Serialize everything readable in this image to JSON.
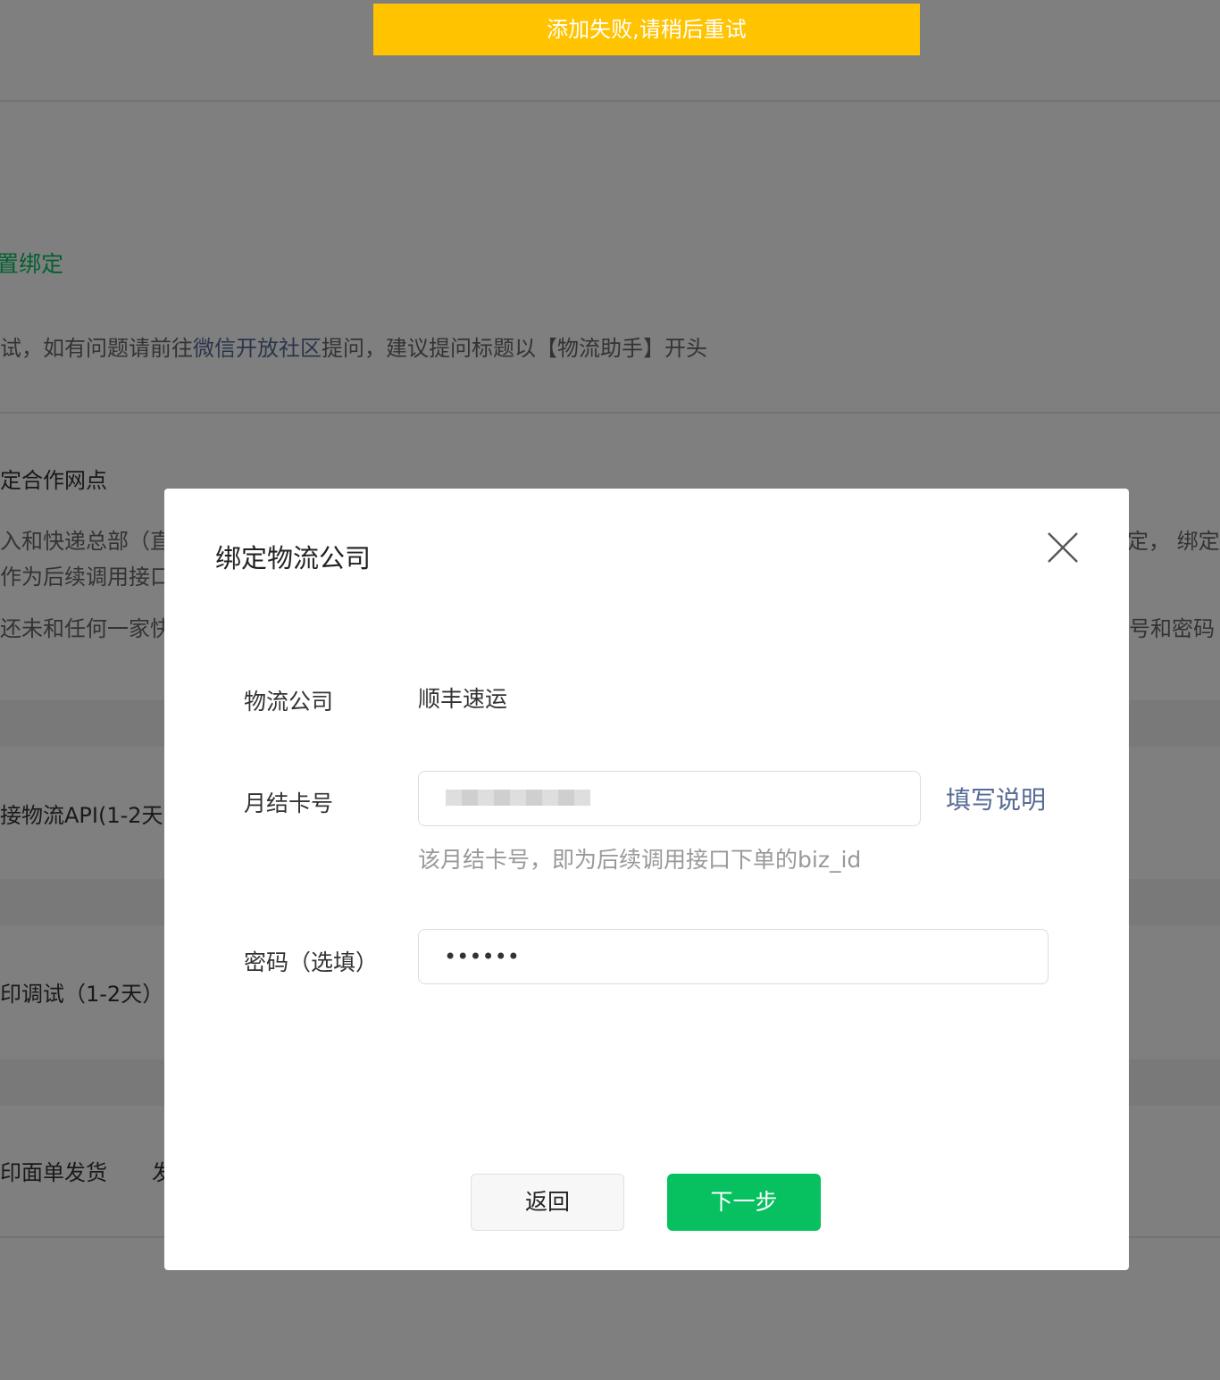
{
  "background": {
    "section_title": "置绑定",
    "notice_prefix": "试，如有问题请前往",
    "notice_link": "微信开放社区",
    "notice_suffix": "提问，建议提问标题以【物流助手】开头",
    "step1_title": "定合作网点",
    "step1_desc_line1_left": "入和快递总部（直",
    "step1_desc_line1_right": "定，  绑定",
    "step1_desc_line2_left": "作为后续调用接口",
    "step1_desc_line3_left": "还未和任何一家快",
    "step1_desc_line3_right": "号和密码",
    "step2_title": "接物流API(1-2天)",
    "step3_title": "印调试（1-2天）",
    "step4_title": "印面单发货",
    "step4_extra": "发"
  },
  "toast": {
    "text": "添加失败,请稍后重试",
    "color": "#ffc300"
  },
  "dialog": {
    "title": "绑定物流公司",
    "close_icon": "close-icon",
    "fields": {
      "company_label": "物流公司",
      "company_value": "顺丰速运",
      "card_label": "月结卡号",
      "card_hint": "该月结卡号，即为后续调用接口下单的biz_id",
      "help_link": "填写说明",
      "password_label": "密码（选填）",
      "password_value": "••••••"
    },
    "buttons": {
      "back": "返回",
      "next": "下一步"
    },
    "accent_color": "#07c160",
    "link_color": "#576b95"
  }
}
